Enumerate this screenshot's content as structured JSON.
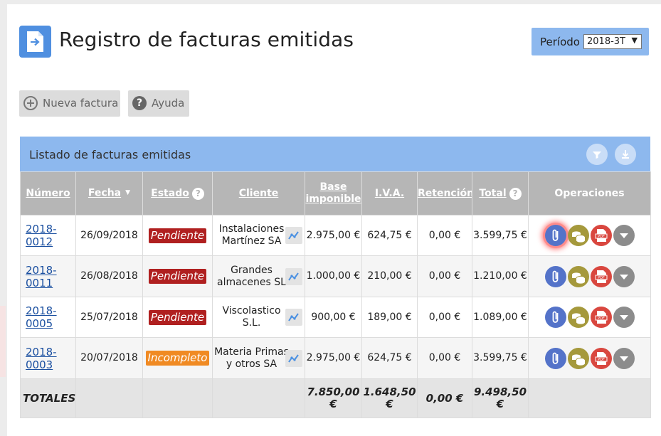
{
  "header": {
    "title": "Registro de facturas emitidas",
    "period_label": "Período",
    "period_value": "2018-3T"
  },
  "toolbar": {
    "new_invoice_label": "Nueva factura",
    "help_label": "Ayuda"
  },
  "list": {
    "title": "Listado de facturas emitidas",
    "columns": {
      "numero": "Número",
      "fecha": "Fecha",
      "estado": "Estado",
      "cliente": "Cliente",
      "base": "Base imponible",
      "iva": "I.V.A.",
      "retencion": "Retención",
      "total": "Total",
      "operaciones": "Operaciones"
    },
    "rows": [
      {
        "numero": "2018-0012",
        "fecha": "26/09/2018",
        "estado": "Pendiente",
        "estado_type": "pend",
        "cliente": "Instalaciones Martínez SA",
        "base": "2.975,00 €",
        "iva": "624,75 €",
        "retencion": "0,00 €",
        "total": "3.599,75 €"
      },
      {
        "numero": "2018-0011",
        "fecha": "26/08/2018",
        "estado": "Pendiente",
        "estado_type": "pend",
        "cliente": "Grandes almacenes SL",
        "base": "1.000,00 €",
        "iva": "210,00 €",
        "retencion": "0,00 €",
        "total": "1.210,00 €"
      },
      {
        "numero": "2018-0005",
        "fecha": "25/07/2018",
        "estado": "Pendiente",
        "estado_type": "pend",
        "cliente": "Viscolastico S.L.",
        "base": "900,00 €",
        "iva": "189,00 €",
        "retencion": "0,00 €",
        "total": "1.089,00 €"
      },
      {
        "numero": "2018-0003",
        "fecha": "20/07/2018",
        "estado": "Incompleto",
        "estado_type": "inc",
        "cliente": "Materia Primas y otros SA",
        "base": "2.975,00 €",
        "iva": "624,75 €",
        "retencion": "0,00 €",
        "total": "3.599,75 €"
      }
    ],
    "totals": {
      "label": "TOTALES",
      "base": "7.850,00 €",
      "iva": "1.648,50 €",
      "retencion": "0,00 €",
      "total": "9.498,50 €"
    }
  },
  "icons": {
    "header": "document-arrow-icon",
    "new": "plus-circle-icon",
    "help": "question-circle-icon",
    "filter": "filter-icon",
    "download": "download-icon",
    "chart": "chart-icon",
    "ops": [
      "paperclip-icon",
      "coins-icon",
      "pdf-icon",
      "chevron-down-icon"
    ]
  },
  "colors": {
    "accent": "#8db8ee",
    "header_bg": "#b6b6b6",
    "pendiente": "#b02020",
    "incompleto": "#f08a23",
    "link": "#1a4fa0"
  }
}
